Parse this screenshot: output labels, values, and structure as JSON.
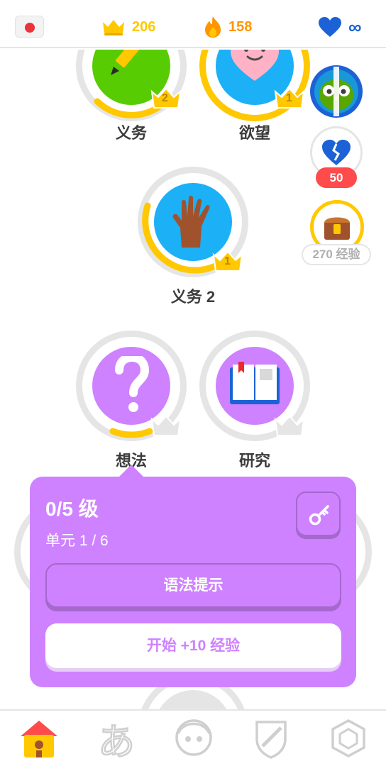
{
  "topbar": {
    "flag_icon": "japan-flag-icon",
    "crowns": "206",
    "streak": "158",
    "hearts": "∞",
    "colors": {
      "crown": "#ffc800",
      "fire": "#ff9600",
      "heart": "#1cb0f6"
    }
  },
  "path": {
    "nodes": [
      {
        "label": "义务",
        "level": "2",
        "icon": "pencil-icon",
        "color": "#58cc02"
      },
      {
        "label": "欲望",
        "level": "1",
        "icon": "heart-face-icon",
        "color": "#1cb0f6"
      },
      {
        "label": "义务 2",
        "level": "1",
        "icon": "hand-icon",
        "color": "#1cb0f6"
      },
      {
        "label": "想法",
        "level": "",
        "icon": "question-icon",
        "color": "#ce82ff"
      },
      {
        "label": "研究",
        "level": "",
        "icon": "book-icon",
        "color": "#ce82ff"
      }
    ]
  },
  "side": {
    "league_icon": "owl-league-icon",
    "hearts_refill": "50",
    "chest_xp": "270 经验"
  },
  "popup": {
    "title": "0/5 级",
    "unit": "单元 1 / 6",
    "grammar_label": "语法提示",
    "start_label": "开始 +10 经验",
    "color": "#ce82ff"
  },
  "nav": {
    "items": [
      "home-icon",
      "characters-icon",
      "profile-icon",
      "league-shield-icon",
      "shop-icon"
    ]
  }
}
